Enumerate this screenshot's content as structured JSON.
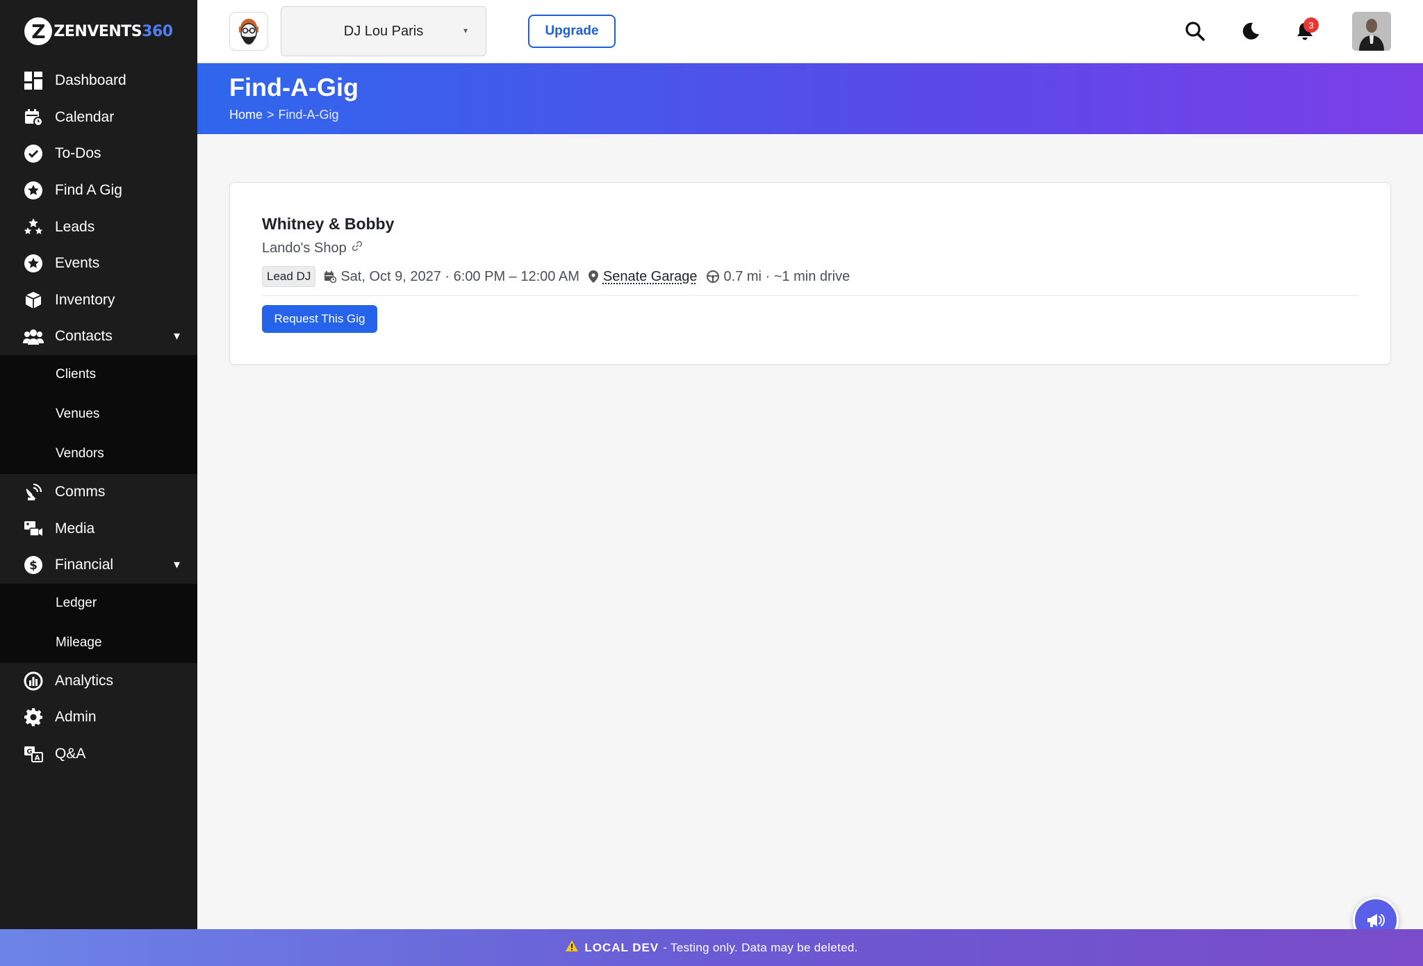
{
  "app": {
    "logo_text_main": "ZENVENTS",
    "logo_text_accent": "360"
  },
  "sidebar": {
    "items": [
      {
        "label": "Dashboard",
        "icon": "dashboard-icon"
      },
      {
        "label": "Calendar",
        "icon": "calendar-icon"
      },
      {
        "label": "To-Dos",
        "icon": "check-circle-icon"
      },
      {
        "label": "Find A Gig",
        "icon": "star-circle-icon"
      },
      {
        "label": "Leads",
        "icon": "stars-icon"
      },
      {
        "label": "Events",
        "icon": "star-circle-icon"
      },
      {
        "label": "Inventory",
        "icon": "box-icon"
      },
      {
        "label": "Contacts",
        "icon": "users-icon",
        "expanded": true,
        "children": [
          "Clients",
          "Venues",
          "Vendors"
        ]
      },
      {
        "label": "Comms",
        "icon": "satellite-dish-icon"
      },
      {
        "label": "Media",
        "icon": "photo-video-icon"
      },
      {
        "label": "Financial",
        "icon": "dollar-circle-icon",
        "expanded": true,
        "children": [
          "Ledger",
          "Mileage"
        ]
      },
      {
        "label": "Analytics",
        "icon": "chart-circle-icon"
      },
      {
        "label": "Admin",
        "icon": "gear-icon"
      },
      {
        "label": "Q&A",
        "icon": "language-icon"
      }
    ]
  },
  "topbar": {
    "account_name": "DJ Lou Paris",
    "upgrade_label": "Upgrade",
    "notification_count": "3"
  },
  "header": {
    "title": "Find-A-Gig",
    "breadcrumb": {
      "home": "Home",
      "separator": ">",
      "current": "Find-A-Gig"
    }
  },
  "gig": {
    "title": "Whitney & Bobby",
    "venue_group": "Lando's Shop",
    "role": "Lead DJ",
    "datetime": "Sat, Oct 9, 2027 · 6:00 PM – 12:00 AM",
    "venue": "Senate Garage",
    "distance": "0.7 mi · ~1 min drive",
    "request_label": "Request This Gig"
  },
  "banner": {
    "label": "LOCAL DEV",
    "message": "- Testing only. Data may be deleted."
  },
  "colors": {
    "sidebar_bg": "#1c1c1c",
    "primary": "#2563eb",
    "header_gradient_start": "#2f67ec",
    "header_gradient_end": "#7b3fe8",
    "badge": "#e53935"
  }
}
